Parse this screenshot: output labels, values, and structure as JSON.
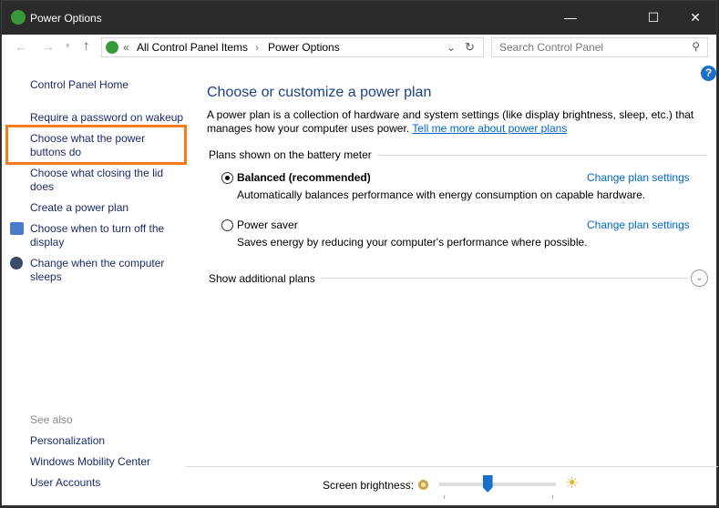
{
  "window": {
    "title": "Power Options"
  },
  "address": {
    "crumbs": [
      "All Control Panel Items",
      "Power Options"
    ],
    "prefix": "«"
  },
  "search": {
    "placeholder": "Search Control Panel"
  },
  "left": {
    "home": "Control Panel Home",
    "items": [
      "Require a password on wakeup",
      "Choose what the power buttons do",
      "Choose what closing the lid does",
      "Create a power plan",
      "Choose when to turn off the display",
      "Change when the computer sleeps"
    ],
    "see_also_label": "See also",
    "see_also": [
      "Personalization",
      "Windows Mobility Center",
      "User Accounts"
    ]
  },
  "main": {
    "title": "Choose or customize a power plan",
    "desc": "A power plan is a collection of hardware and system settings (like display brightness, sleep, etc.) that manages how your computer uses power.",
    "desc_link": "Tell me more about power plans",
    "section": "Plans shown on the battery meter",
    "plans": [
      {
        "name": "Balanced (recommended)",
        "desc": "Automatically balances performance with energy consumption on capable hardware.",
        "link": "Change plan settings",
        "selected": true
      },
      {
        "name": "Power saver",
        "desc": "Saves energy by reducing your computer's performance where possible.",
        "link": "Change plan settings",
        "selected": false
      }
    ],
    "additional": "Show additional plans"
  },
  "footer": {
    "brightness_label": "Screen brightness:",
    "brightness_percent": 40
  },
  "colors": {
    "highlight": "#f47b20",
    "link": "#0066cc"
  }
}
